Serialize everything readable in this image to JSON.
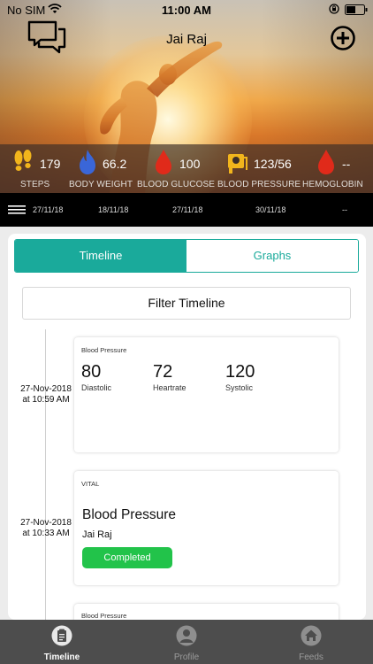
{
  "status_bar": {
    "carrier": "No SIM",
    "time": "11:00 AM"
  },
  "header": {
    "title": "Jai Raj",
    "chat_icon": "chat-bubbles-icon",
    "add_icon": "plus-circle-icon"
  },
  "vitals": [
    {
      "icon": "footsteps-icon",
      "value": "179",
      "label": "STEPS"
    },
    {
      "icon": "flame-icon",
      "value": "66.2",
      "label": "BODY WEIGHT"
    },
    {
      "icon": "blood-drop-icon",
      "value": "100",
      "label": "BLOOD GLUCOSE"
    },
    {
      "icon": "bp-monitor-icon",
      "value": "123/56",
      "label": "BLOOD PRESSURE"
    },
    {
      "icon": "blood-drop-icon",
      "value": "--",
      "label": "HEMOGLOBIN"
    }
  ],
  "dates": [
    "27/11/18",
    "18/11/18",
    "27/11/18",
    "30/11/18",
    "--"
  ],
  "tabs": {
    "active": "Timeline",
    "inactive": "Graphs"
  },
  "filter_label": "Filter Timeline",
  "timeline": [
    {
      "date": "27-Nov-2018",
      "time": "at 10:59 AM",
      "label": "Blood Pressure",
      "readings": [
        {
          "value": "80",
          "name": "Diastolic"
        },
        {
          "value": "72",
          "name": "Heartrate"
        },
        {
          "value": "120",
          "name": "Systolic"
        }
      ]
    },
    {
      "date": "27-Nov-2018",
      "time": "at 10:33 AM",
      "label": "VITAL",
      "title": "Blood Pressure",
      "user": "Jai Raj",
      "status": "Completed"
    },
    {
      "label": "Blood Pressure"
    }
  ],
  "tabbar": [
    {
      "icon": "clipboard-icon",
      "label": "Timeline",
      "active": true
    },
    {
      "icon": "person-icon",
      "label": "Profile",
      "active": false
    },
    {
      "icon": "home-icon",
      "label": "Feeds",
      "active": false
    }
  ],
  "colors": {
    "accent": "#1aaa9b",
    "completed": "#22c34a",
    "tabbar": "#4d4d4d",
    "drop": "#e02a1a",
    "flame": "#3a66d8",
    "amber": "#f2b51c"
  }
}
